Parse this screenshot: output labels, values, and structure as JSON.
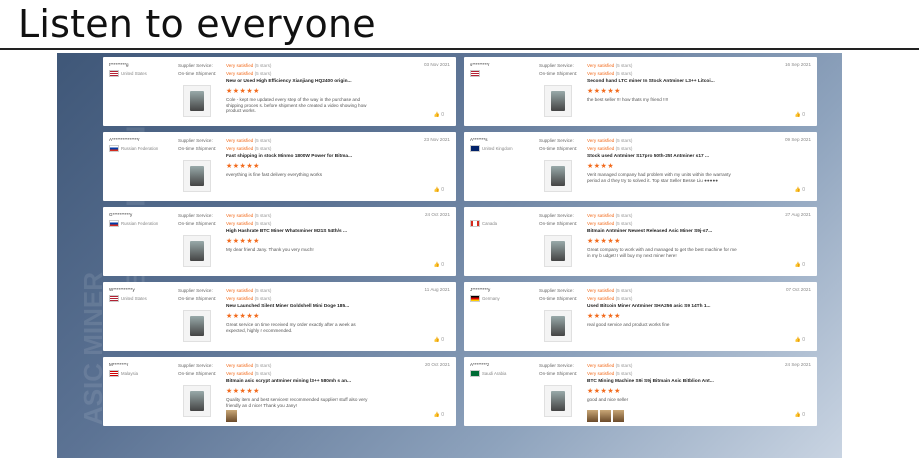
{
  "heading": "Listen to everyone",
  "labels": {
    "supplier_service": "Supplier Service:",
    "ontime": "On-time Shipment:"
  },
  "rating_text": "Very satisfied",
  "rating_stars": "(5 stars)",
  "like_count": "0",
  "colors": {
    "accent": "#f26b1d"
  },
  "reviews": [
    {
      "buyer": "t*********g",
      "country": "United States",
      "flag": "us",
      "date": "03 Nov 2021",
      "product": "New or Used High Efficiency Xianjiang HQ2400 origin...",
      "stars": "★★★★★",
      "comment": "Cole - kept me updated every step of the way in the purchase and shipping proces s. before shipment she created a video showing how product works.",
      "pics": 0
    },
    {
      "buyer": "s*********r",
      "country": "",
      "flag": "us",
      "date": "16 Sep 2021",
      "product": "Second hand LTC miner In Stock Antminer L3++ Litcoi...",
      "stars": "★★★★★",
      "comment": "the best seller !!! how thats my friend !!!!",
      "pics": 0
    },
    {
      "buyer": "A***************r",
      "country": "Russian Federation",
      "flag": "ru",
      "date": "23 Nov 2021",
      "product": "Fast shipping in stock Minmo 1800W Power for Bitma...",
      "stars": "★★★★★",
      "comment": "everything is fine fast delivery everything works",
      "pics": 0
    },
    {
      "buyer": "A*******s",
      "country": "United Kingdom",
      "flag": "gb",
      "date": "09 Sep 2021",
      "product": "Stock used Antminer S17pro 50th-25t Antminer s17 ...",
      "stars": "★★★★",
      "comment": "Verit managed company had problem with my units within the warranty period an d they try to solved it. Top star Seller Besse Liu ●●●●●",
      "pics": 0
    },
    {
      "buyer": "G**********y",
      "country": "Russian Federation",
      "flag": "ru",
      "date": "24 Oct 2021",
      "product": "High Hashrate BTC Miner Whatsminer M21S 54th/s ...",
      "stars": "★★★★★",
      "comment": "My dear friend Jany. Thank you very much!",
      "pics": 0
    },
    {
      "buyer": "",
      "country": "Canada",
      "flag": "ca",
      "date": "27 Aug 2021",
      "product": "Bitmain Antminer Newest Released Asic Miner S9j-s7...",
      "stars": "★★★★★",
      "comment": "Great company to work with and managed to get the best machine for me in my b udget! I will buy my next miner here!",
      "pics": 0
    },
    {
      "buyer": "W***********y",
      "country": "United States",
      "flag": "us",
      "date": "11 Aug 2021",
      "product": "New Launched Silent Miner Goldshell Mini Doge 185...",
      "stars": "★★★★★",
      "comment": "Great service on time received my order exactly after a week as expected, highly r ecommended.",
      "pics": 0
    },
    {
      "buyer": "J*********y",
      "country": "Germany",
      "flag": "de",
      "date": "07 Oct 2021",
      "product": "Used Bitcoin Miner Antminer SHA256 asic S9 14Th 1...",
      "stars": "★★★★★",
      "comment": "real good service and product works fine",
      "pics": 0
    },
    {
      "buyer": "M********r",
      "country": "Malaysia",
      "flag": "my",
      "date": "20 Oct 2021",
      "product": "Bitmain asic scrypt antminer mining l3++ 580mh s an...",
      "stars": "★★★★★",
      "comment": "Quality item and best services! recommended supplier! stuff also very friendly an d nice! Thank you Jany!",
      "pics": 1
    },
    {
      "buyer": "A********z",
      "country": "Saudi Arabia",
      "flag": "sa",
      "date": "24 Sep 2021",
      "product": "BTC Mining Machine S9i S9j Bitmain Asic Bitblion Ant...",
      "stars": "★★★★★",
      "comment": "good and nice seller",
      "pics": 3
    }
  ]
}
